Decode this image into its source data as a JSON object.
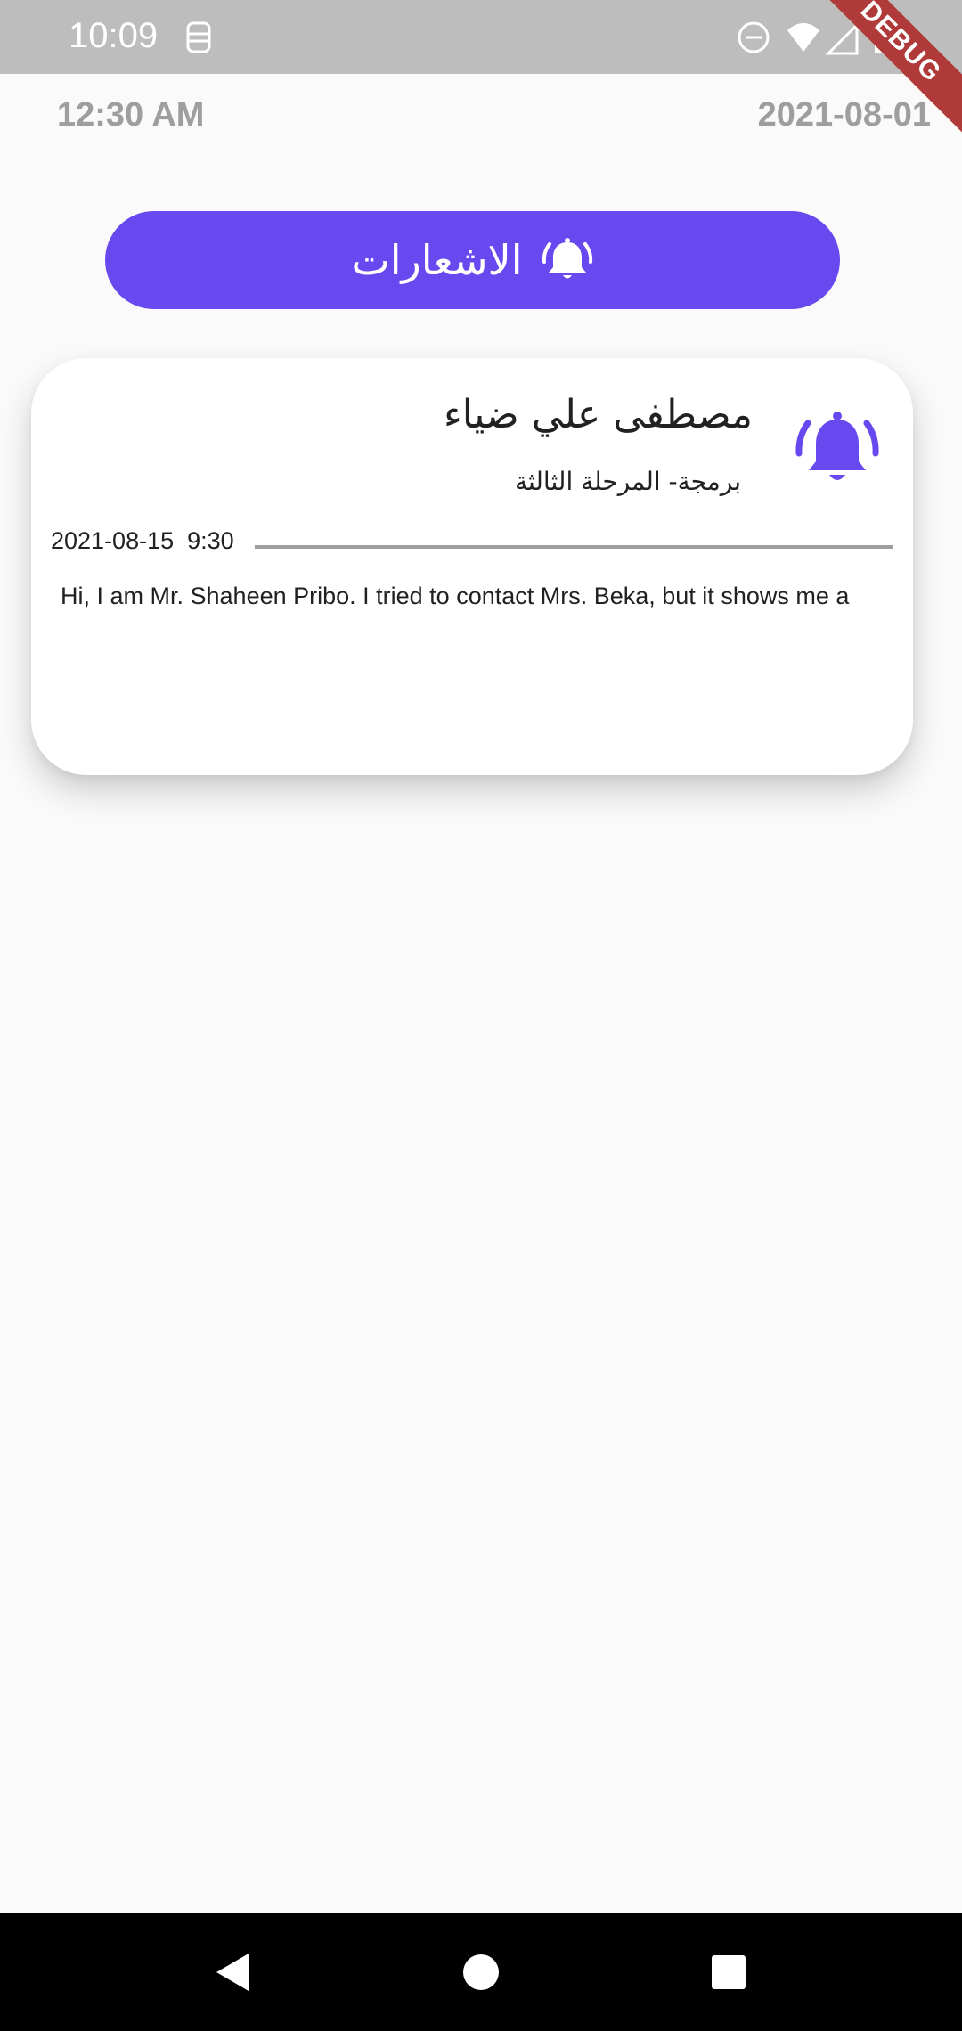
{
  "status_bar": {
    "time": "10:09",
    "debug_label": "DEBUG"
  },
  "header": {
    "time": "12:30 AM",
    "date": "2021-08-01"
  },
  "notifications_button": {
    "label": "الاشعارات",
    "icon": "bell-ring-icon",
    "color": "#6849ef"
  },
  "notification_card": {
    "icon": "bell-ring-icon",
    "sender_name": "مصطفى علي ضياء",
    "subtitle": "برمجة- المرحلة الثالثة",
    "datetime": "2021-08-15  9:30",
    "message": "Hi, I am Mr. Shaheen Pribo. I tried to contact Mrs. Beka, but it shows me a"
  },
  "colors": {
    "accent": "#6849ef",
    "status_bar_bg": "#bdbdbd",
    "page_bg": "#fafafa",
    "muted_text": "#9e9e9e",
    "debug_banner": "#b03a3a"
  },
  "nav_bar": {
    "back": "back-triangle-icon",
    "home": "home-circle-icon",
    "recents": "recents-square-icon"
  }
}
